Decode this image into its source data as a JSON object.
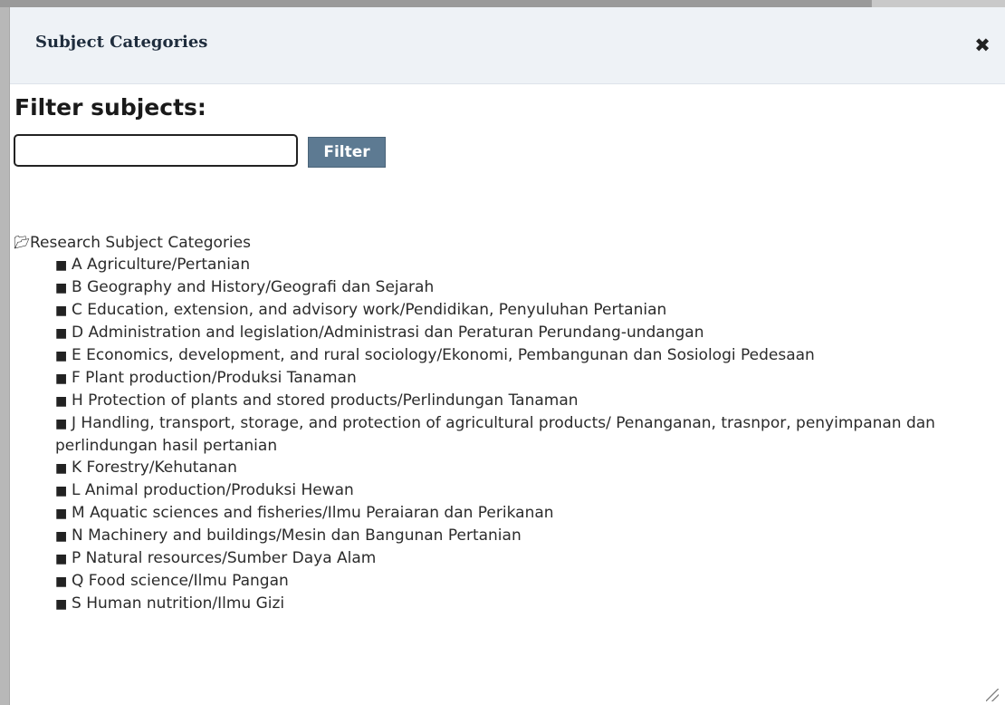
{
  "dialog": {
    "title": "Subject Categories",
    "close_icon": "close-icon"
  },
  "filter": {
    "heading": "Filter subjects:",
    "input_value": "",
    "button_label": "Filter"
  },
  "tree": {
    "root_label": "Research Subject Categories",
    "items": [
      {
        "label": "A Agriculture/Pertanian"
      },
      {
        "label": "B Geography and History/Geografi dan Sejarah"
      },
      {
        "label": "C Education, extension, and advisory work/Pendidikan, Penyuluhan Pertanian"
      },
      {
        "label": "D Administration and legislation/Administrasi dan Peraturan Perundang-undangan"
      },
      {
        "label": "E Economics, development, and rural sociology/Ekonomi, Pembangunan dan Sosiologi Pedesaan"
      },
      {
        "label": "F Plant production/Produksi Tanaman"
      },
      {
        "label": "H Protection of plants and stored products/Perlindungan Tanaman"
      },
      {
        "label": "J Handling, transport, storage, and protection of agricultural products/ Penanganan, trasnpor, penyimpanan dan perlindungan hasil pertanian"
      },
      {
        "label": "K Forestry/Kehutanan"
      },
      {
        "label": "L Animal production/Produksi Hewan"
      },
      {
        "label": "M Aquatic sciences and fisheries/Ilmu Peraiaran dan Perikanan"
      },
      {
        "label": "N Machinery and buildings/Mesin dan Bangunan Pertanian"
      },
      {
        "label": "P Natural resources/Sumber Daya Alam"
      },
      {
        "label": "Q Food science/Ilmu Pangan"
      },
      {
        "label": "S Human nutrition/Ilmu Gizi"
      }
    ]
  }
}
